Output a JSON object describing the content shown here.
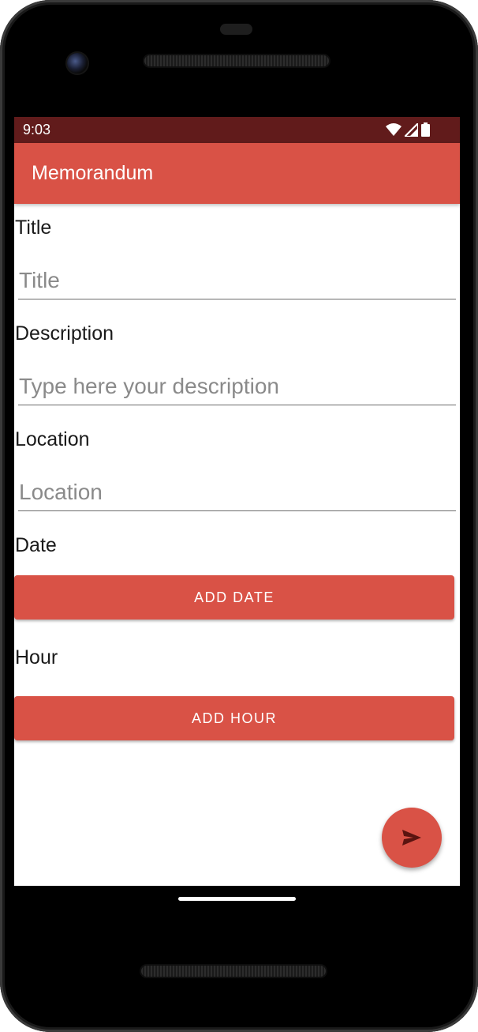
{
  "status_bar": {
    "time": "9:03",
    "icons": [
      "wifi-icon",
      "cell-signal-icon",
      "battery-icon"
    ],
    "background": "#611b1b"
  },
  "app_bar": {
    "title": "Memorandum",
    "color": "#d95246"
  },
  "form": {
    "title": {
      "label": "Title",
      "placeholder": "Title",
      "value": ""
    },
    "description": {
      "label": "Description",
      "placeholder": "Type here your description",
      "value": ""
    },
    "location": {
      "label": "Location",
      "placeholder": "Location",
      "value": ""
    },
    "date": {
      "label": "Date",
      "button_label": "ADD DATE"
    },
    "hour": {
      "label": "Hour",
      "button_label": "ADD HOUR"
    }
  },
  "fab": {
    "icon": "send-icon"
  },
  "accent_color": "#d95246"
}
